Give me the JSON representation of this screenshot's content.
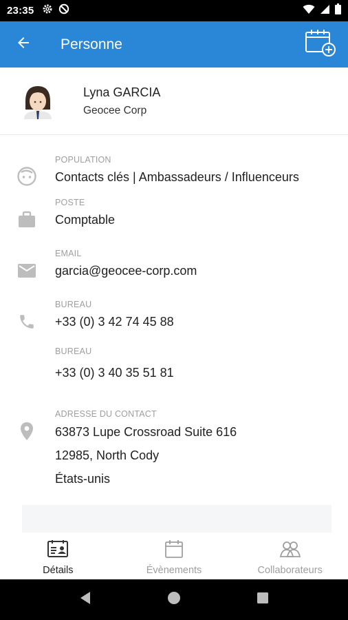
{
  "status_bar": {
    "time": "23:35",
    "left_icons": [
      "gear-icon",
      "do-not-disturb-icon"
    ],
    "right_icons": [
      "wifi-icon",
      "cellular-signal-icon",
      "battery-icon"
    ]
  },
  "app_bar": {
    "title": "Personne",
    "color": "#2a86d6",
    "icons": [
      "arrow-back-icon",
      "calendar-add-icon"
    ]
  },
  "profile": {
    "name": "Lyna GARCIA",
    "company": "Geocee Corp"
  },
  "details": {
    "population": {
      "label": "POPULATION",
      "value": "Contacts clés | Ambassadeurs / Influenceurs"
    },
    "poste": {
      "label": "POSTE",
      "value": "Comptable"
    },
    "email": {
      "label": "EMAIL",
      "value": "garcia@geocee-corp.com"
    },
    "phones": [
      {
        "label": "BUREAU",
        "value": "+33 (0) 3 42 74 45 88"
      },
      {
        "label": "BUREAU",
        "value": "+33 (0) 3 40 35 51 81"
      }
    ],
    "address": {
      "label": "ADRESSE DU CONTACT",
      "lines": [
        "63873 Lupe Crossroad Suite 616",
        "12985, North Cody",
        "États-unis"
      ]
    }
  },
  "bottom_nav": {
    "items": [
      {
        "label": "Détails",
        "active": true,
        "icon": "contact-card-icon"
      },
      {
        "label": "Évènements",
        "active": false,
        "icon": "calendar-icon"
      },
      {
        "label": "Collaborateurs",
        "active": false,
        "icon": "people-icon"
      }
    ]
  },
  "system_nav": [
    "back-triangle-icon",
    "home-circle-icon",
    "recents-square-icon"
  ]
}
